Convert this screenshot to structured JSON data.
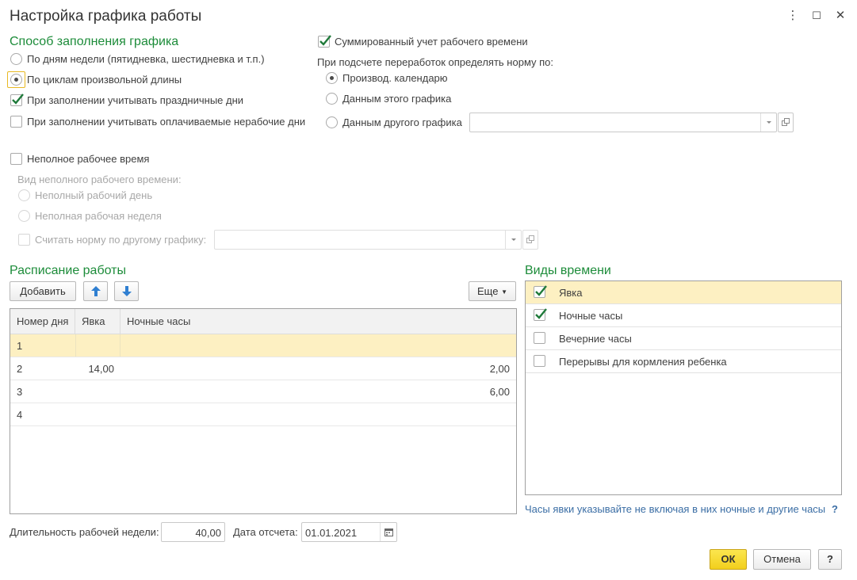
{
  "window": {
    "title": "Настройка графика работы",
    "menu_icon": "⋮",
    "maximize_icon": "☐",
    "close_icon": "✕"
  },
  "fill_method": {
    "section_title": "Способ заполнения графика",
    "option_weekdays": "По дням недели (пятидневка, шестидневка и т.п.)",
    "option_cycles": "По циклам произвольной длины",
    "selected": "cycles",
    "holidays_label": "При заполнении учитывать праздничные дни",
    "holidays_checked": true,
    "paid_days_label": "При заполнении учитывать оплачиваемые нерабочие дни",
    "paid_days_checked": false
  },
  "summary": {
    "summarized_label": "Суммированный учет рабочего времени",
    "summarized_checked": true,
    "norm_heading": "При подсчете переработок определять норму по:",
    "opt_calendar": "Производ. календарю",
    "opt_this": "Данным этого графика",
    "opt_other": "Данным другого графика",
    "selected": "calendar",
    "other_value": ""
  },
  "part_time": {
    "label": "Неполное рабочее время",
    "checked": false,
    "kind_label": "Вид неполного рабочего времени:",
    "opt_day": "Неполный рабочий день",
    "opt_week": "Неполная рабочая неделя",
    "norm_other_label": "Считать норму по другому графику:",
    "norm_other_value": ""
  },
  "schedule": {
    "section_title": "Расписание работы",
    "add_button": "Добавить",
    "more_button": "Еще",
    "columns": [
      "Номер дня",
      "Явка",
      "Ночные часы"
    ],
    "rows": [
      {
        "day": "1",
        "attendance": "",
        "night": ""
      },
      {
        "day": "2",
        "attendance": "14,00",
        "night": "2,00"
      },
      {
        "day": "3",
        "attendance": "",
        "night": "6,00"
      },
      {
        "day": "4",
        "attendance": "",
        "night": ""
      }
    ]
  },
  "time_types": {
    "section_title": "Виды времени",
    "items": [
      {
        "label": "Явка",
        "checked": true
      },
      {
        "label": "Ночные часы",
        "checked": true
      },
      {
        "label": "Вечерние часы",
        "checked": false
      },
      {
        "label": "Перерывы для кормления ребенка",
        "checked": false
      }
    ],
    "hint": "Часы явки указывайте не включая в них ночные и другие часы",
    "hint_help": "?"
  },
  "bottom": {
    "week_duration_label": "Длительность рабочей недели:",
    "week_duration_value": "40,00",
    "start_date_label": "Дата отсчета:",
    "start_date_value": "01.01.2021",
    "ok_button": "ОК",
    "cancel_button": "Отмена",
    "help_button": "?"
  },
  "colors": {
    "accent_green": "#1d8c3a",
    "selection": "#fdf0c2",
    "ok_yellow": "#f5d62a",
    "link_blue": "#3b6ea5"
  }
}
